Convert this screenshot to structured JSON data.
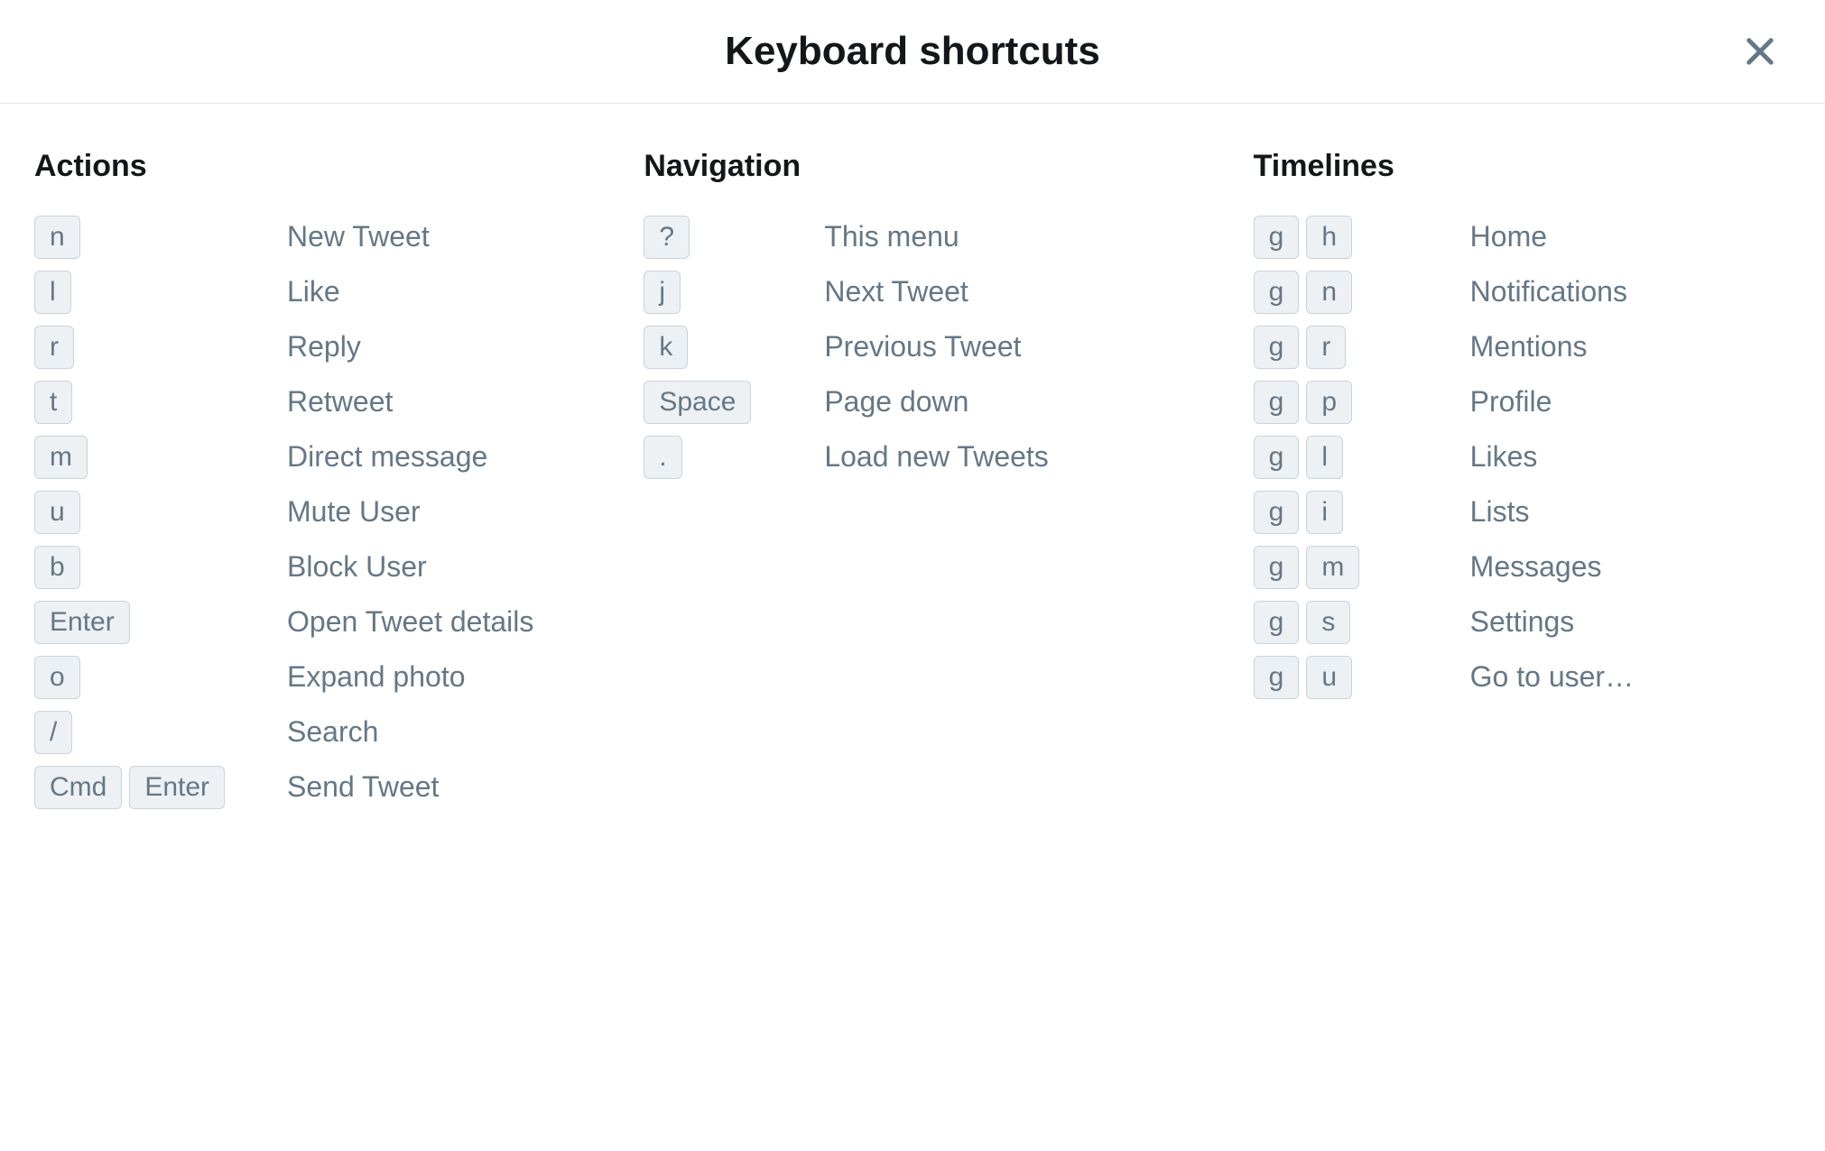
{
  "title": "Keyboard shortcuts",
  "sections": [
    {
      "heading": "Actions",
      "rows": [
        {
          "keys": [
            "n"
          ],
          "desc": "New Tweet"
        },
        {
          "keys": [
            "l"
          ],
          "desc": "Like"
        },
        {
          "keys": [
            "r"
          ],
          "desc": "Reply"
        },
        {
          "keys": [
            "t"
          ],
          "desc": "Retweet"
        },
        {
          "keys": [
            "m"
          ],
          "desc": "Direct message"
        },
        {
          "keys": [
            "u"
          ],
          "desc": "Mute User"
        },
        {
          "keys": [
            "b"
          ],
          "desc": "Block User"
        },
        {
          "keys": [
            "Enter"
          ],
          "desc": "Open Tweet details"
        },
        {
          "keys": [
            "o"
          ],
          "desc": "Expand photo"
        },
        {
          "keys": [
            "/"
          ],
          "desc": "Search"
        },
        {
          "keys": [
            "Cmd",
            "Enter"
          ],
          "desc": "Send Tweet"
        }
      ]
    },
    {
      "heading": "Navigation",
      "rows": [
        {
          "keys": [
            "?"
          ],
          "desc": "This menu"
        },
        {
          "keys": [
            "j"
          ],
          "desc": "Next Tweet"
        },
        {
          "keys": [
            "k"
          ],
          "desc": "Previous Tweet"
        },
        {
          "keys": [
            "Space"
          ],
          "desc": "Page down"
        },
        {
          "keys": [
            "."
          ],
          "desc": "Load new Tweets"
        }
      ]
    },
    {
      "heading": "Timelines",
      "rows": [
        {
          "keys": [
            "g",
            "h"
          ],
          "desc": "Home"
        },
        {
          "keys": [
            "g",
            "n"
          ],
          "desc": "Notifications"
        },
        {
          "keys": [
            "g",
            "r"
          ],
          "desc": "Mentions"
        },
        {
          "keys": [
            "g",
            "p"
          ],
          "desc": "Profile"
        },
        {
          "keys": [
            "g",
            "l"
          ],
          "desc": "Likes"
        },
        {
          "keys": [
            "g",
            "i"
          ],
          "desc": "Lists"
        },
        {
          "keys": [
            "g",
            "m"
          ],
          "desc": "Messages"
        },
        {
          "keys": [
            "g",
            "s"
          ],
          "desc": "Settings"
        },
        {
          "keys": [
            "g",
            "u"
          ],
          "desc": "Go to user…"
        }
      ]
    }
  ]
}
